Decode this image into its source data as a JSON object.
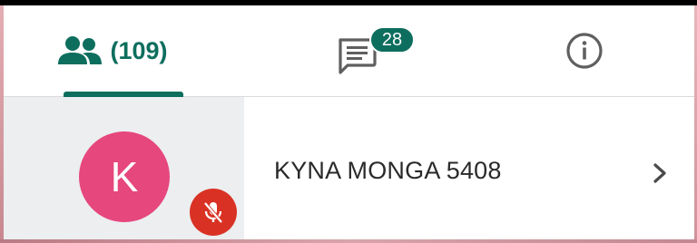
{
  "colors": {
    "accent": "#0d6e5e",
    "avatar": "#e6477d",
    "muted": "#d93224",
    "icon_gray": "#5f5f5f"
  },
  "tabs": [
    {
      "id": "participants",
      "icon": "people-icon",
      "count_label": "(109)",
      "selected": true
    },
    {
      "id": "chat",
      "icon": "chat-icon",
      "badge": "28",
      "selected": false
    },
    {
      "id": "info",
      "icon": "info-icon",
      "selected": false
    }
  ],
  "participant": {
    "avatar_letter": "K",
    "name": "KYNA MONGA 5408",
    "mic_status_icon": "mic-off-icon",
    "trailing_icon": "chevron-right-icon"
  }
}
